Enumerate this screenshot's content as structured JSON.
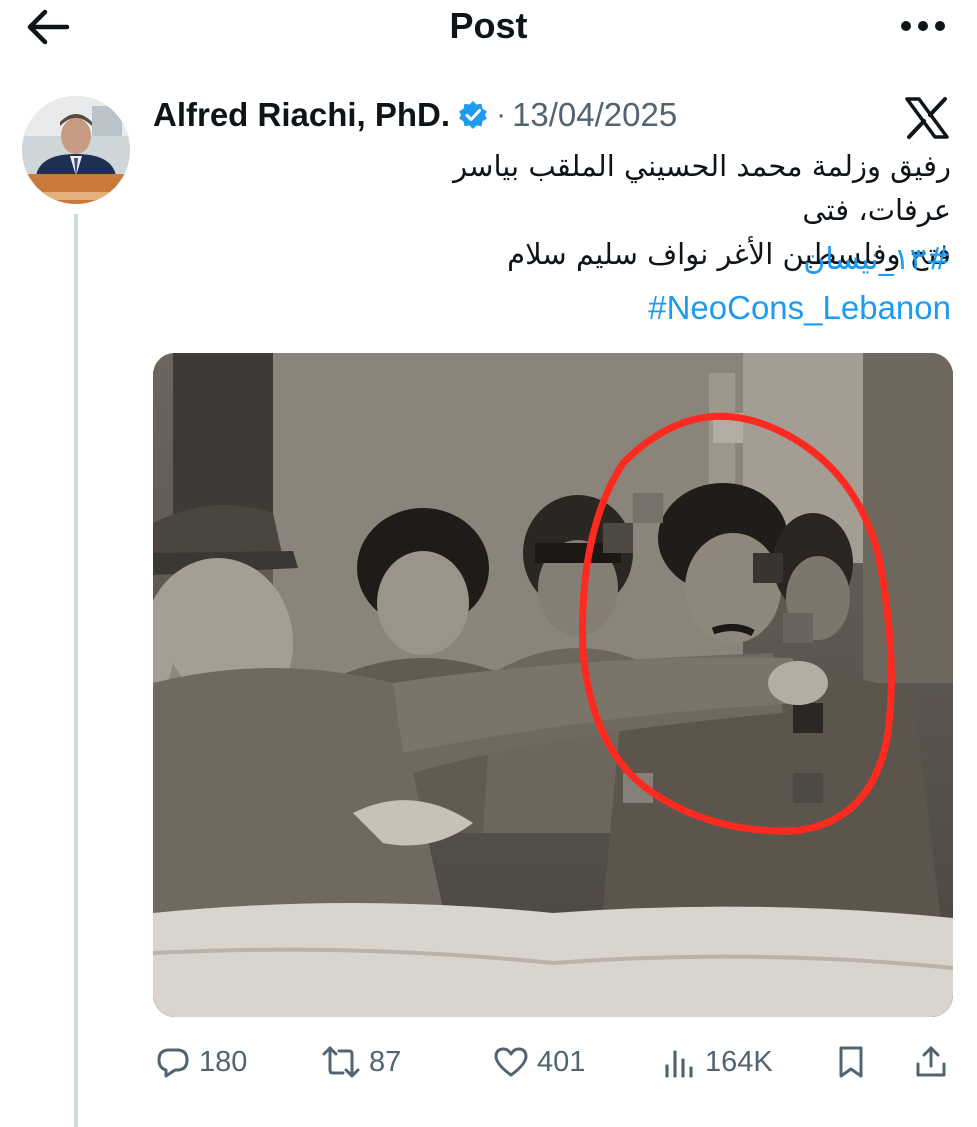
{
  "header": {
    "title": "Post",
    "back_icon": "arrow-left-icon",
    "more_icon": "more-horizontal-icon"
  },
  "post": {
    "author_name": "Alfred Riachi, PhD.",
    "verified": true,
    "separator": "·",
    "date": "13/04/2025",
    "platform_icon": "x-logo-icon",
    "text_line_1": "رفيق وزلمة محمد الحسيني الملقب بياسر عرفات، فتى",
    "text_line_2": "فتح وفلسطين الأغر نواف سليم سلام",
    "hashtags": [
      "#١٣_نيسان",
      "#NeoCons_Lebanon"
    ]
  },
  "actions": {
    "replies": "180",
    "retweets": "87",
    "likes": "401",
    "views": "164K"
  },
  "colors": {
    "accent": "#1d9bf0",
    "muted": "#536471",
    "text": "#0f1419",
    "thread_line": "#cfd9de",
    "highlight_circle": "#ff2a1f"
  }
}
